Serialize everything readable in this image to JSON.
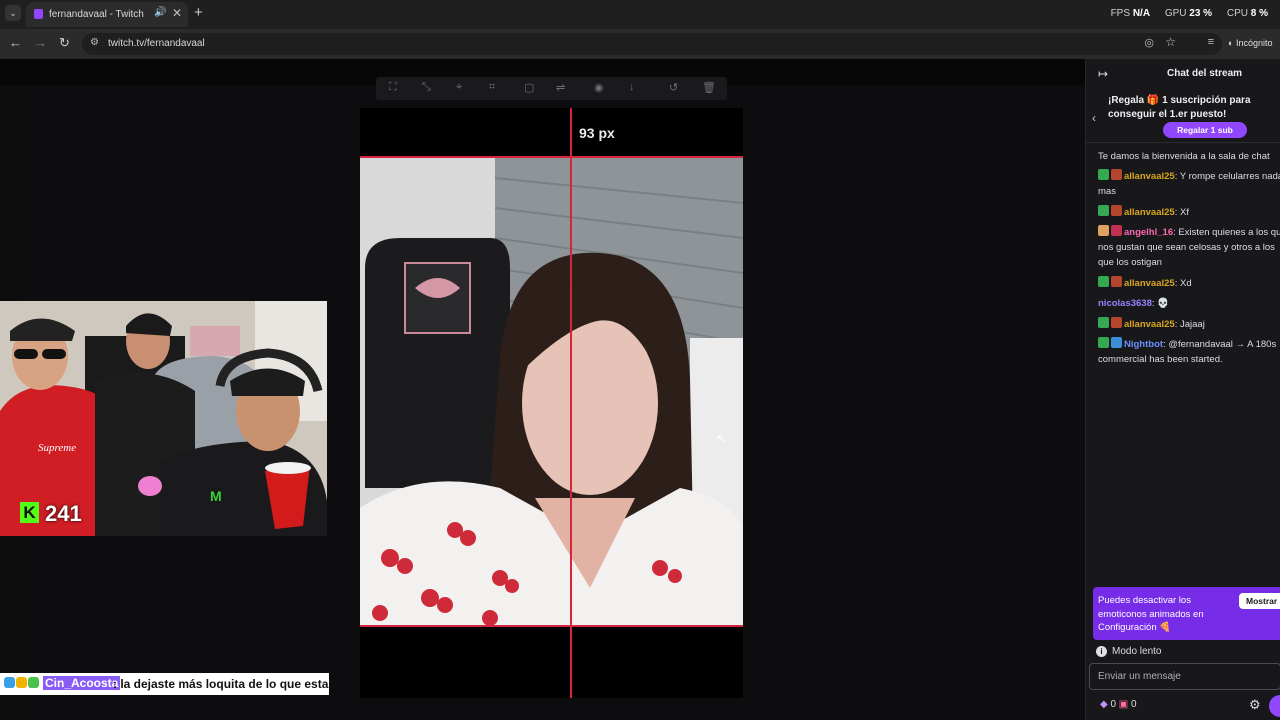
{
  "browser": {
    "tab_title": "fernandavaal - Twitch",
    "new_tab": "+",
    "url": "twitch.tv/fernandavaal",
    "profile": "Incógnito",
    "perf": [
      {
        "label": "FPS",
        "value": "N/A"
      },
      {
        "label": "GPU",
        "value": "23 %"
      },
      {
        "label": "CPU",
        "value": "8 %"
      }
    ]
  },
  "overlay": {
    "measure_label": "93 px",
    "kick_viewers": "241"
  },
  "bottom_chat": {
    "user": "Cin_Acoosta",
    "message": ": la dejaste más loquita de lo que estaba ya"
  },
  "chat": {
    "title": "Chat del stream",
    "gift_banner": "¡Regala 🎁 1 suscripción para conseguir el 1.er puesto!",
    "gift_button": "Regalar 1 sub",
    "welcome": "Te damos la bienvenida a la sala de chat",
    "messages": [
      {
        "user": "allanvaal25",
        "color": "#daa520",
        "text": ": Y rompe celularres nada mas"
      },
      {
        "user": "allanvaal25",
        "color": "#daa520",
        "text": ": Xf"
      },
      {
        "user": "angelhl_16",
        "color": "#ff69b4",
        "text": ": Existen quienes a los que nos gustan que sean celosas y otros a los que los ostigan"
      },
      {
        "user": "allanvaal25",
        "color": "#daa520",
        "text": ": Xd"
      },
      {
        "user": "nicolas3638",
        "color": "#9b82ff",
        "text": ": 💀"
      },
      {
        "user": "allanvaal25",
        "color": "#daa520",
        "text": ": Jajaaj"
      },
      {
        "user": "Nightbot",
        "color": "#6c8fff",
        "text": ": @fernandavaal → A 180s commercial has been started."
      }
    ],
    "promo_text": "Puedes desactivar los emoticonos animados en Configuración 🍕",
    "promo_button": "Mostrar",
    "slow_mode": "Modo lento",
    "input_placeholder": "Enviar un mensaje",
    "points_a": "0",
    "points_b": "0"
  }
}
